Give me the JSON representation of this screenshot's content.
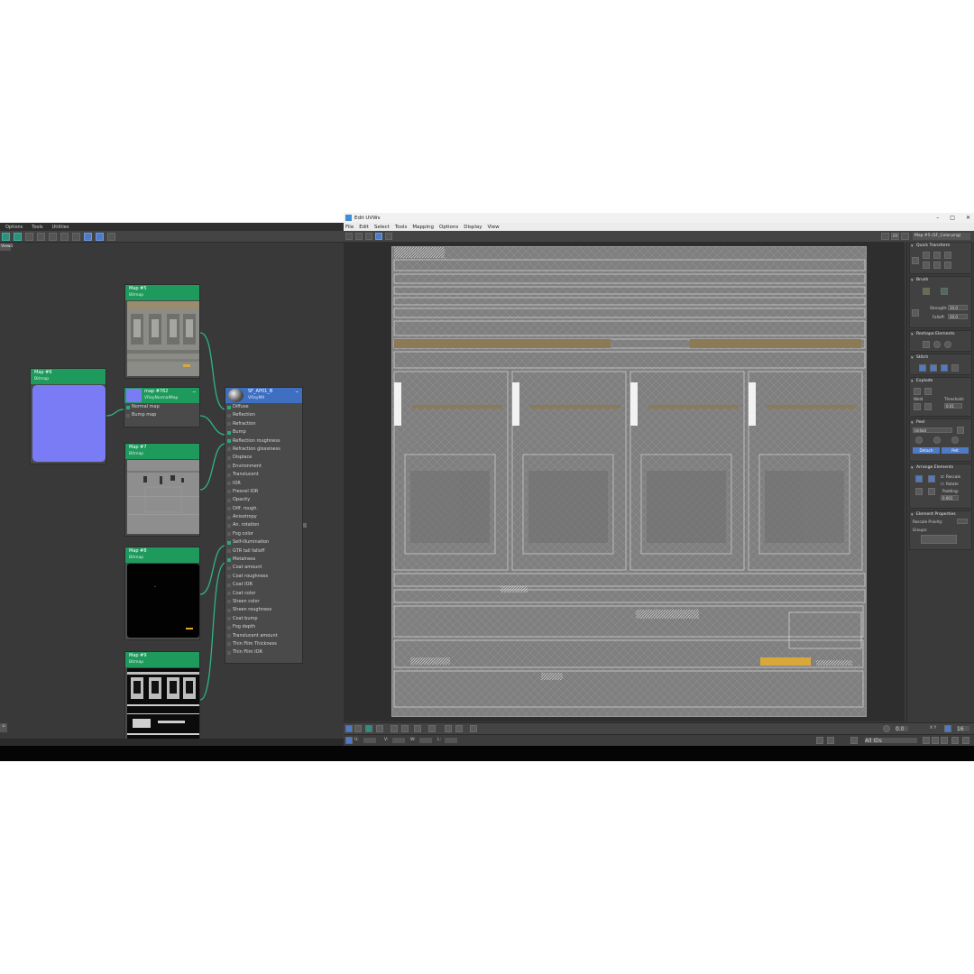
{
  "slate": {
    "menu": [
      "Options",
      "Tools",
      "Utilities"
    ],
    "view_tab": "View1",
    "nodes": {
      "map5": {
        "title": "Map #5",
        "type": "Bitmap"
      },
      "map6": {
        "title": "Map #6",
        "type": "Bitmap"
      },
      "map762": {
        "title": "map #762",
        "type": "VRayNormalMap",
        "slots": [
          "Normal map",
          "Bump map"
        ]
      },
      "map7": {
        "title": "Map #7",
        "type": "Bitmap"
      },
      "map8": {
        "title": "Map #8",
        "type": "Bitmap"
      },
      "map9": {
        "title": "Map #9",
        "type": "Bitmap"
      },
      "material": {
        "title": "SF_AP01_B",
        "type": "VRayMtl",
        "slots": [
          {
            "label": "Diffuse",
            "connected": true
          },
          {
            "label": "Reflection",
            "connected": false
          },
          {
            "label": "Refraction",
            "connected": false
          },
          {
            "label": "Bump",
            "connected": true
          },
          {
            "label": "Reflection roughness",
            "connected": true
          },
          {
            "label": "Refraction glossiness",
            "connected": false
          },
          {
            "label": "Displace",
            "connected": false
          },
          {
            "label": "Environment",
            "connected": false
          },
          {
            "label": "Translucent",
            "connected": false
          },
          {
            "label": "IOR",
            "connected": false
          },
          {
            "label": "Fresnel IOR",
            "connected": false
          },
          {
            "label": "Opacity",
            "connected": false
          },
          {
            "label": "Diff. rough.",
            "connected": false
          },
          {
            "label": "Anisotropy",
            "connected": false
          },
          {
            "label": "An. rotation",
            "connected": false
          },
          {
            "label": "Fog color",
            "connected": false
          },
          {
            "label": "Self-illumination",
            "connected": true
          },
          {
            "label": "GTR tail falloff",
            "connected": false
          },
          {
            "label": "Metalness",
            "connected": true
          },
          {
            "label": "Coat amount",
            "connected": false
          },
          {
            "label": "Coat roughness",
            "connected": false
          },
          {
            "label": "Coat IOR",
            "connected": false
          },
          {
            "label": "Coat color",
            "connected": false
          },
          {
            "label": "Sheen color",
            "connected": false
          },
          {
            "label": "Sheen roughness",
            "connected": false
          },
          {
            "label": "Coat bump",
            "connected": false
          },
          {
            "label": "Fog depth",
            "connected": false
          },
          {
            "label": "Translucent amount",
            "connected": false
          },
          {
            "label": "Thin Film Thickness",
            "connected": false
          },
          {
            "label": "Thin Film IOR",
            "connected": false
          }
        ]
      }
    }
  },
  "uvw": {
    "title": "Edit UVWs",
    "window_controls": [
      "–",
      "□",
      "✕"
    ],
    "menu": [
      "File",
      "Edit",
      "Select",
      "Tools",
      "Mapping",
      "Options",
      "Display",
      "View"
    ],
    "map_dropdown": "Map #5 (SF_Color.png)",
    "uv_label": "UV",
    "panel": {
      "quick_transform": "Quick Transform",
      "brush": "Brush",
      "strength_label": "Strength:",
      "strength_value": "10.0",
      "falloff_label": "Falloff:",
      "falloff_value": "20.0",
      "reshape": "Reshape Elements",
      "stitch": "Stitch",
      "explode": "Explode",
      "weld": "Weld",
      "threshold_label": "Threshold:",
      "threshold_value": "0.01",
      "peel": "Peel",
      "peel_mode": "Unfold",
      "detach": "Detach",
      "pelt": "Pelt",
      "arrange": "Arrange Elements",
      "rescale": "Rescale",
      "rotate": "Rotate",
      "padding_label": "Padding:",
      "padding_value": "0.001",
      "element_props": "Element Properties",
      "rescale_priority": "Rescale Priority:",
      "groups": "Groups:"
    },
    "bottom": {
      "u_label": "U:",
      "v_label": "V:",
      "w_label": "W:",
      "l_label": "L:",
      "zoom_value": "0.0",
      "xy_label": "X Y",
      "grid_value": "16",
      "all_ids": "All IDs"
    }
  },
  "colors": {
    "node_header": "#1f9a5d",
    "material_header": "#3e6fc0",
    "wire": "#2fb38a",
    "normal_map": "#7a7cf5",
    "accent": "#4e7ac6"
  }
}
